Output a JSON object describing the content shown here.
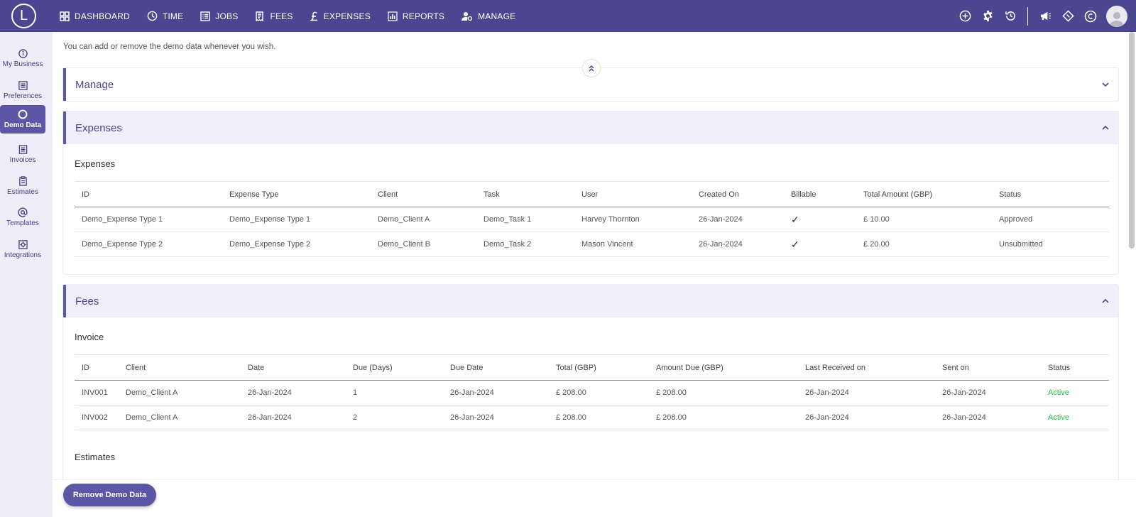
{
  "app": {
    "logo_letter": "L"
  },
  "nav": {
    "items": [
      {
        "label": "DASHBOARD",
        "icon": "grid-icon"
      },
      {
        "label": "TIME",
        "icon": "clock-icon"
      },
      {
        "label": "JOBS",
        "icon": "list-icon"
      },
      {
        "label": "FEES",
        "icon": "receipt-icon"
      },
      {
        "label": "EXPENSES",
        "icon": "pound-icon"
      },
      {
        "label": "REPORTS",
        "icon": "bar-chart-icon"
      },
      {
        "label": "MANAGE",
        "icon": "manage-users-icon"
      }
    ]
  },
  "sidebar": {
    "items": [
      {
        "label": "My Business",
        "icon": "info-icon"
      },
      {
        "label": "Preferences",
        "icon": "preferences-icon"
      },
      {
        "label": "Demo Data",
        "icon": "circle-icon",
        "active": true
      },
      {
        "label": "Invoices",
        "icon": "invoice-icon"
      },
      {
        "label": "Estimates",
        "icon": "clipboard-icon"
      },
      {
        "label": "Templates",
        "icon": "at-icon"
      },
      {
        "label": "Integrations",
        "icon": "integrations-icon"
      }
    ]
  },
  "main": {
    "info_text": "You can add or remove the demo data whenever you wish.",
    "manage_panel": {
      "title": "Manage"
    },
    "expenses_panel": {
      "title": "Expenses",
      "section_title": "Expenses",
      "headers": [
        "ID",
        "Expense Type",
        "Client",
        "Task",
        "User",
        "Created On",
        "Billable",
        "Total Amount (GBP)",
        "Status"
      ],
      "rows": [
        [
          "Demo_Expense Type 1",
          "Demo_Expense Type 1",
          "Demo_Client A",
          "Demo_Task 1",
          "Harvey Thornton",
          "26-Jan-2024",
          "✓",
          "£ 10.00",
          "Approved"
        ],
        [
          "Demo_Expense Type 2",
          "Demo_Expense Type 2",
          "Demo_Client B",
          "Demo_Task 2",
          "Mason Vincent",
          "26-Jan-2024",
          "✓",
          "£ 20.00",
          "Unsubmitted"
        ]
      ]
    },
    "fees_panel": {
      "title": "Fees",
      "invoice_title": "Invoice",
      "headers": [
        "ID",
        "Client",
        "Date",
        "Due (Days)",
        "Due Date",
        "Total (GBP)",
        "Amount Due (GBP)",
        "Last Received on",
        "Sent on",
        "Status"
      ],
      "rows": [
        [
          "INV001",
          "Demo_Client A",
          "26-Jan-2024",
          "1",
          "26-Jan-2024",
          "£ 208.00",
          "£ 208.00",
          "26-Jan-2024",
          "26-Jan-2024",
          "Active"
        ],
        [
          "INV002",
          "Demo_Client A",
          "26-Jan-2024",
          "2",
          "26-Jan-2024",
          "£ 208.00",
          "£ 208.00",
          "26-Jan-2024",
          "26-Jan-2024",
          "Active"
        ]
      ],
      "estimates_title": "Estimates"
    }
  },
  "footer": {
    "remove_button": "Remove Demo Data"
  },
  "colors": {
    "brand": "#4b4690",
    "accent": "#5b56a6",
    "panel_bg": "#efeefa",
    "active_status": "#27c24c"
  }
}
